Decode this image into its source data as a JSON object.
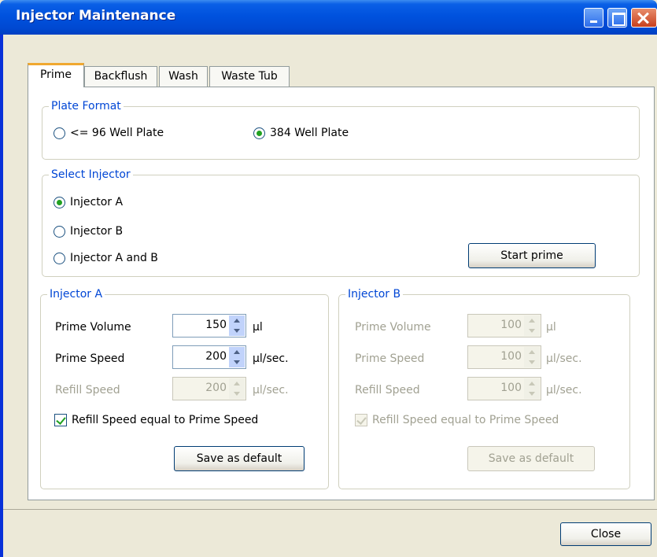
{
  "window": {
    "title": "Injector Maintenance"
  },
  "tabs": [
    {
      "label": "Prime",
      "active": true
    },
    {
      "label": "Backflush",
      "active": false
    },
    {
      "label": "Wash",
      "active": false
    },
    {
      "label": "Waste Tub",
      "active": false
    }
  ],
  "plate_format": {
    "legend": "Plate Format",
    "options": [
      {
        "label": "<= 96 Well Plate",
        "checked": false
      },
      {
        "label": "384 Well Plate",
        "checked": true
      }
    ]
  },
  "select_injector": {
    "legend": "Select Injector",
    "options": [
      {
        "label": "Injector A",
        "checked": true
      },
      {
        "label": "Injector B",
        "checked": false
      },
      {
        "label": "Injector A and B",
        "checked": false
      }
    ],
    "start_button": "Start prime"
  },
  "injector_a": {
    "legend": "Injector A",
    "prime_volume_label": "Prime Volume",
    "prime_volume_value": "150",
    "prime_volume_unit": "µl",
    "prime_speed_label": "Prime Speed",
    "prime_speed_value": "200",
    "prime_speed_unit": "µl/sec.",
    "refill_speed_label": "Refill Speed",
    "refill_speed_value": "200",
    "refill_speed_unit": "µl/sec.",
    "refill_equal_label": "Refill Speed equal to Prime Speed",
    "refill_equal_checked": true,
    "save_button": "Save as default"
  },
  "injector_b": {
    "legend": "Injector B",
    "prime_volume_label": "Prime Volume",
    "prime_volume_value": "100",
    "prime_volume_unit": "µl",
    "prime_speed_label": "Prime Speed",
    "prime_speed_value": "100",
    "prime_speed_unit": "µl/sec.",
    "refill_speed_label": "Refill Speed",
    "refill_speed_value": "100",
    "refill_speed_unit": "µl/sec.",
    "refill_equal_label": "Refill Speed equal to Prime Speed",
    "refill_equal_checked": true,
    "save_button": "Save as default"
  },
  "footer": {
    "close_button": "Close"
  },
  "colors": {
    "accent": "#0046D5",
    "titlebar": "#0052DE",
    "radio_dot": "#21A121",
    "disabled_text": "#A1A192"
  }
}
